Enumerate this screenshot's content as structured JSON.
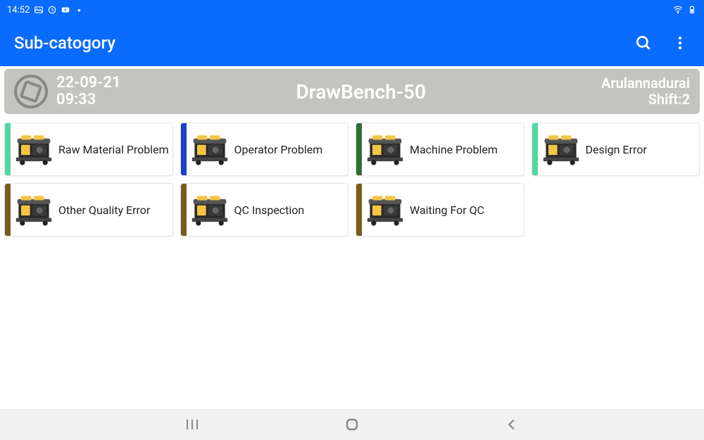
{
  "status": {
    "time": "14:52",
    "icons": [
      "image-icon",
      "sync-icon",
      "youtube-icon",
      "dot-icon"
    ],
    "right_icons": [
      "wifi-icon",
      "battery-icon"
    ]
  },
  "appbar": {
    "title": "Sub-catogory",
    "search_icon": "search-icon",
    "menu_icon": "more-vert-icon"
  },
  "info": {
    "date": "22-09-21",
    "time": "09:33",
    "machine": "DrawBench-50",
    "user": "Arulannadurai",
    "shift": "Shift:2"
  },
  "stripe_colors": {
    "teal": "#4fd6a3",
    "blue": "#1d3fc9",
    "darkgreen": "#2f6e35",
    "brown": "#7a5a1f"
  },
  "cards": [
    {
      "label": "Raw Material Problem",
      "stripe": "teal"
    },
    {
      "label": "Operator Problem",
      "stripe": "blue"
    },
    {
      "label": "Machine Problem",
      "stripe": "darkgreen"
    },
    {
      "label": "Design Error",
      "stripe": "teal"
    },
    {
      "label": "Other Quality Error",
      "stripe": "brown"
    },
    {
      "label": "QC Inspection",
      "stripe": "brown"
    },
    {
      "label": "Waiting For QC",
      "stripe": "brown"
    }
  ],
  "nav": {
    "recent": "recent-apps",
    "home": "home",
    "back": "back"
  }
}
